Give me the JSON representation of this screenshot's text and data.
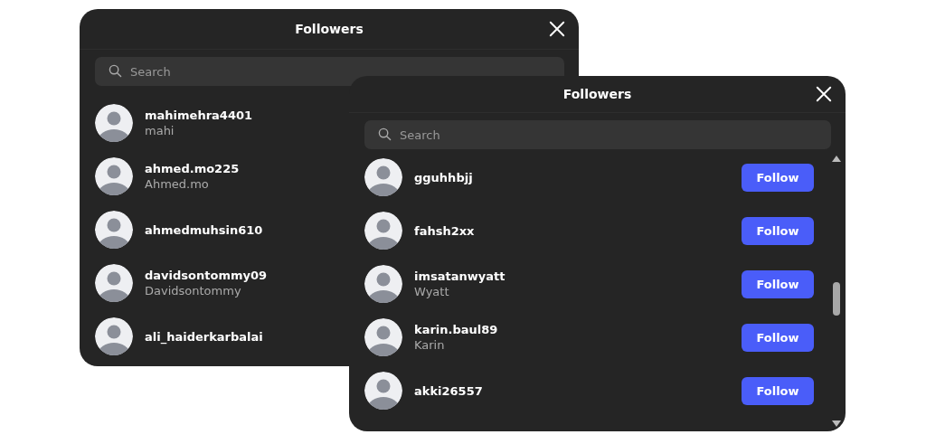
{
  "dialogs": [
    {
      "title": "Followers",
      "search": {
        "placeholder": "Search"
      },
      "scrollbar": false,
      "followers": [
        {
          "username": "mahimehra4401",
          "name": "mahi"
        },
        {
          "username": "ahmed.mo225",
          "name": "Ahmed.mo"
        },
        {
          "username": "ahmedmuhsin610"
        },
        {
          "username": "davidsontommy09",
          "name": "Davidsontommy"
        },
        {
          "username": "ali_haiderkarbalai"
        }
      ]
    },
    {
      "title": "Followers",
      "search": {
        "placeholder": "Search"
      },
      "scrollbar": true,
      "followers": [
        {
          "username": "gguhhbjj",
          "button": "Follow"
        },
        {
          "username": "fahsh2xx",
          "button": "Follow"
        },
        {
          "username": "imsatanwyatt",
          "name": "Wyatt",
          "button": "Follow"
        },
        {
          "username": "karin.baul89",
          "name": "Karin",
          "button": "Follow"
        },
        {
          "username": "akki26557",
          "button": "Follow"
        }
      ]
    }
  ]
}
